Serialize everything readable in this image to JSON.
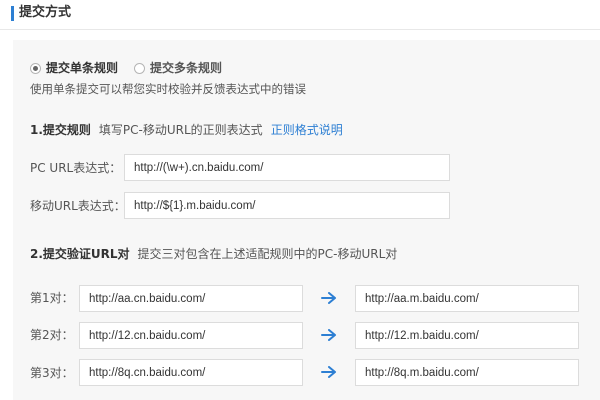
{
  "header": {
    "title": "提交方式"
  },
  "submit_mode": {
    "options": [
      {
        "label": "提交单条规则",
        "checked": true
      },
      {
        "label": "提交多条规则",
        "checked": false
      }
    ],
    "hint": "使用单条提交可以帮您实时校验并反馈表达式中的错误"
  },
  "rule_section": {
    "title": "1.提交规则",
    "description": "填写PC-移动URL的正则表达式",
    "link": "正则格式说明",
    "fields": [
      {
        "label": "PC  URL表达式：",
        "value": "http://(\\w+).cn.baidu.com/"
      },
      {
        "label": "移动URL表达式：",
        "value": "http://${1}.m.baidu.com/"
      }
    ]
  },
  "verify_section": {
    "title": "2.提交验证URL对",
    "description": "提交三对包含在上述适配规则中的PC-移动URL对",
    "pairs": [
      {
        "label": "第1对：",
        "pc": "http://aa.cn.baidu.com/",
        "mobile": "http://aa.m.baidu.com/"
      },
      {
        "label": "第2对：",
        "pc": "http://12.cn.baidu.com/",
        "mobile": "http://12.m.baidu.com/"
      },
      {
        "label": "第3对：",
        "pc": "http://8q.cn.baidu.com/",
        "mobile": "http://8q.m.baidu.com/"
      }
    ]
  },
  "colors": {
    "accent": "#2d7fd3",
    "panel_bg": "#f7f7f7",
    "input_border": "#dcdcdc"
  },
  "icons": {
    "pair_arrow": "arrow-right-icon"
  }
}
